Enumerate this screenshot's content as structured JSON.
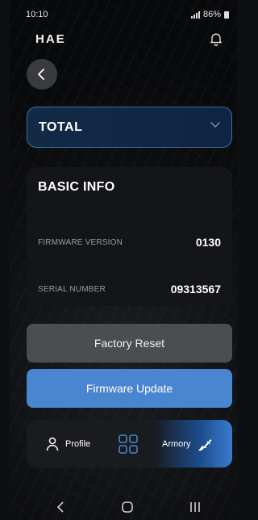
{
  "status": {
    "time": "10:10",
    "battery": "86%"
  },
  "header": {
    "brand": "HAE"
  },
  "dropdown": {
    "selected": "TOTAL"
  },
  "basic_info": {
    "title": "BASIC INFO",
    "rows": [
      {
        "label": "FIRMWARE VERSION",
        "value": "0130"
      },
      {
        "label": "SERIAL NUMBER",
        "value": "09313567"
      }
    ]
  },
  "actions": {
    "factory_reset": "Factory Reset",
    "firmware_update": "Firmware Update"
  },
  "bottom_nav": {
    "profile": "Profile",
    "armory": "Armory"
  },
  "colors": {
    "accent": "#4a86cf",
    "dropdown_border": "#3b6ea8"
  },
  "icons": [
    "bell-icon",
    "back-arrow-icon",
    "chevron-down-icon",
    "person-icon",
    "grid-icon",
    "rifle-icon"
  ]
}
